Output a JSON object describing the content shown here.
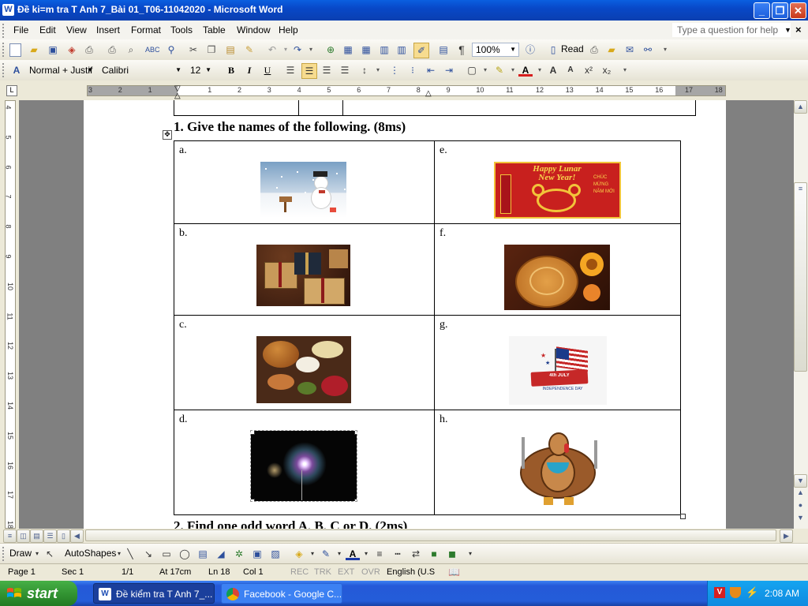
{
  "window": {
    "title": "Đề ki=m tra T Anh 7_Bài 01_T06-11042020 - Microsoft Word",
    "app_icon": "word-icon",
    "buttons": {
      "minimize": "_",
      "restore": "❐",
      "close": "✕"
    }
  },
  "menu": {
    "items": [
      "File",
      "Edit",
      "View",
      "Insert",
      "Format",
      "Tools",
      "Table",
      "Window",
      "Help"
    ],
    "ask_placeholder": "Type a question for help"
  },
  "standard_toolbar": {
    "zoom": "100%",
    "read_label": "Read"
  },
  "formatting_toolbar": {
    "style": "Normal + Justif",
    "font": "Calibri",
    "size": "12"
  },
  "ruler": {
    "numbers": [
      "3",
      "2",
      "1",
      "1",
      "2",
      "3",
      "4",
      "5",
      "6",
      "7",
      "8",
      "9",
      "10",
      "11",
      "12",
      "13",
      "14",
      "15",
      "16",
      "17",
      "18"
    ],
    "vertical_numbers": [
      "4",
      "5",
      "6",
      "7",
      "8",
      "9",
      "10",
      "11",
      "12",
      "13",
      "14",
      "15",
      "16",
      "17",
      "18"
    ]
  },
  "document": {
    "section1_heading": "1.  Give the names of the following. (8ms)",
    "section2_heading": "2.  Find one odd word A, B, C or D. (2ms)",
    "cells": [
      {
        "label": "a.",
        "picture": "snowman-picture"
      },
      {
        "label": "e.",
        "picture": "happy-lunar-new-year-picture",
        "picture_text": "Happy Lunar New Year!",
        "picture_subtext": "CHÚC MỪNG NĂM MỚI"
      },
      {
        "label": "b.",
        "picture": "gift-boxes-picture"
      },
      {
        "label": "f.",
        "picture": "mooncake-picture"
      },
      {
        "label": "c.",
        "picture": "thanksgiving-dinner-picture"
      },
      {
        "label": "g.",
        "picture": "fourth-of-july-picture",
        "picture_text": "4th JULY",
        "picture_subtext": "INDEPENDENCE DAY"
      },
      {
        "label": "d.",
        "picture": "fireworks-picture"
      },
      {
        "label": "h.",
        "picture": "cartoon-turkey-picture"
      }
    ]
  },
  "draw_toolbar": {
    "draw_label": "Draw",
    "autoshapes_label": "AutoShapes"
  },
  "status": {
    "page": "Page  1",
    "sec": "Sec  1",
    "pages": "1/1",
    "at": "At  17cm",
    "ln": "Ln  18",
    "col": "Col  1",
    "rec": "REC",
    "trk": "TRK",
    "ext": "EXT",
    "ovr": "OVR",
    "language": "English (U.S"
  },
  "taskbar": {
    "start_label": "start",
    "items": [
      {
        "label": "Đề kiểm tra T Anh 7_...",
        "icon": "word-icon",
        "active": true
      },
      {
        "label": "Facebook - Google C...",
        "icon": "chrome-icon",
        "active": false
      }
    ],
    "clock": "2:08 AM"
  },
  "colors": {
    "titlebar": "#0a5fe0",
    "taskbar": "#245dd9",
    "start": "#2f8f2f",
    "lunar_red": "#c8201e",
    "lunar_gold": "#f2c43a"
  }
}
